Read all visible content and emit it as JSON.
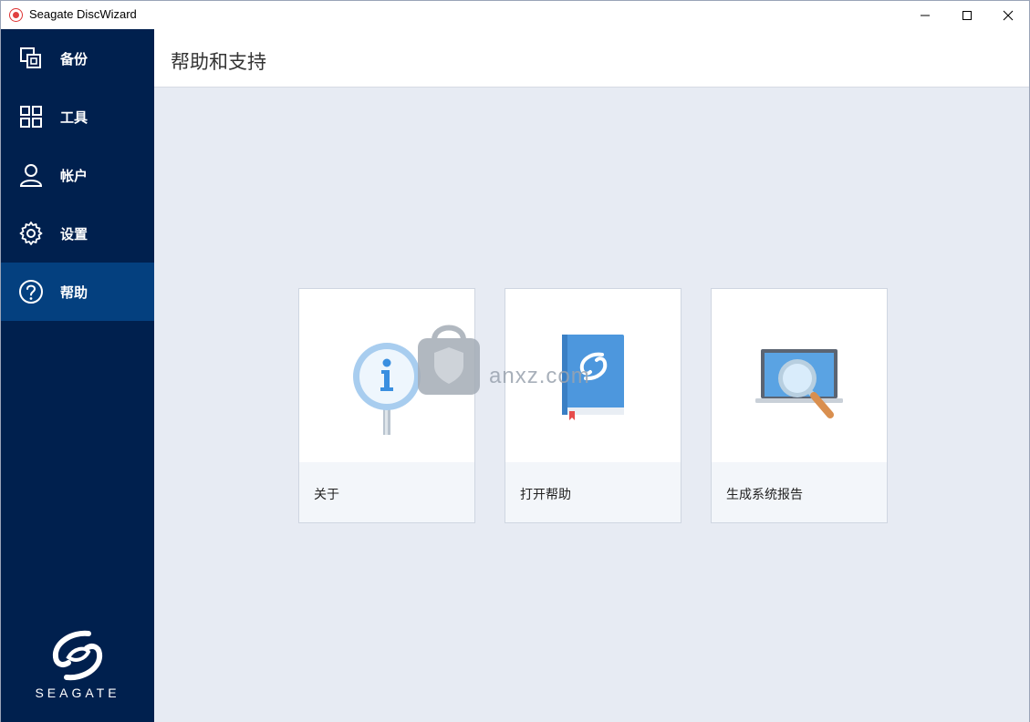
{
  "window": {
    "title": "Seagate DiscWizard"
  },
  "sidebar": {
    "items": [
      {
        "label": "备份",
        "icon": "backup-copy-icon"
      },
      {
        "label": "工具",
        "icon": "tools-grid-icon"
      },
      {
        "label": "帐户",
        "icon": "user-account-icon"
      },
      {
        "label": "设置",
        "icon": "gear-icon"
      },
      {
        "label": "帮助",
        "icon": "help-question-icon",
        "active": true
      }
    ],
    "logo_text": "SEAGATE"
  },
  "main": {
    "page_title": "帮助和支持",
    "cards": [
      {
        "label": "关于",
        "icon": "info-sign-icon"
      },
      {
        "label": "打开帮助",
        "icon": "help-book-icon"
      },
      {
        "label": "生成系统报告",
        "icon": "laptop-magnifier-icon"
      }
    ]
  },
  "watermark": {
    "text": "anxz.com"
  },
  "colors": {
    "sidebar_bg": "#00204e",
    "sidebar_active": "#04407f",
    "main_bg": "#e7ebf3",
    "accent_blue": "#5aa3e3"
  }
}
